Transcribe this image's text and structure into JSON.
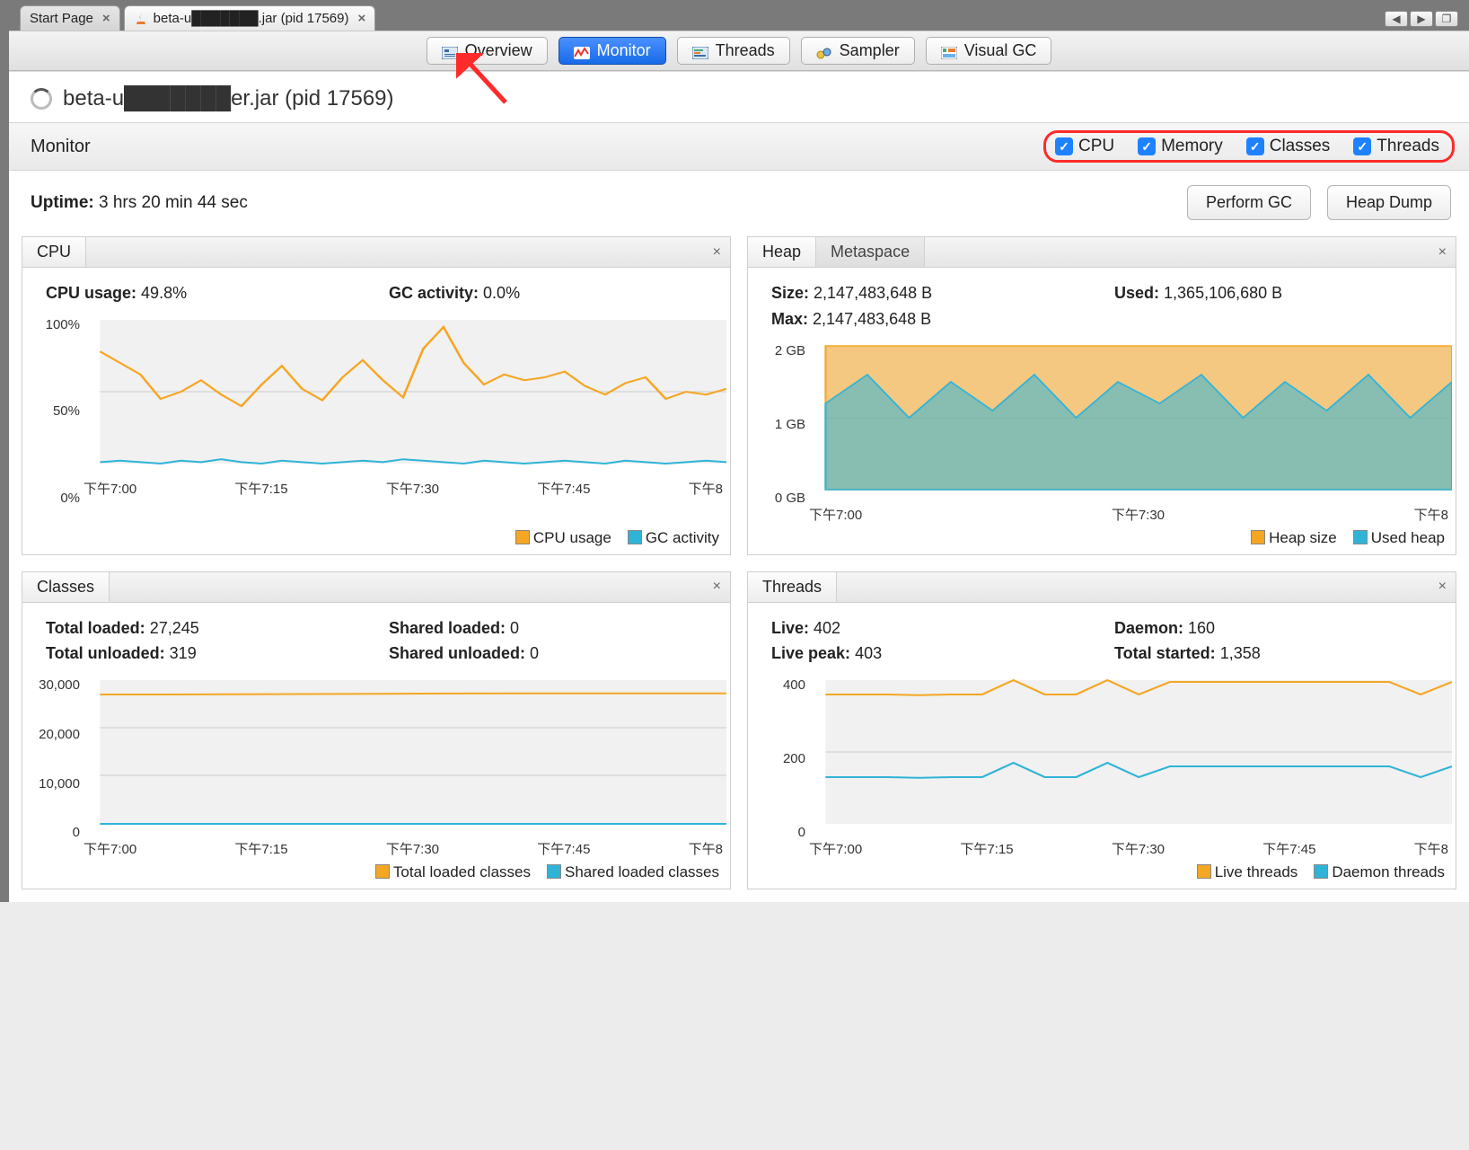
{
  "window": {
    "tabs": [
      {
        "label": "Start Page",
        "active": false
      },
      {
        "label": "beta-u███████.jar (pid 17569)",
        "active": true
      }
    ]
  },
  "nav_tabs": [
    {
      "label": "Overview",
      "selected": false,
      "icon": "overview-icon"
    },
    {
      "label": "Monitor",
      "selected": true,
      "icon": "monitor-icon"
    },
    {
      "label": "Threads",
      "selected": false,
      "icon": "threads-icon"
    },
    {
      "label": "Sampler",
      "selected": false,
      "icon": "sampler-icon"
    },
    {
      "label": "Visual GC",
      "selected": false,
      "icon": "visualgc-icon"
    }
  ],
  "page_title": "beta-u███████er.jar (pid 17569)",
  "section_label": "Monitor",
  "checks": [
    {
      "label": "CPU",
      "checked": true
    },
    {
      "label": "Memory",
      "checked": true
    },
    {
      "label": "Classes",
      "checked": true
    },
    {
      "label": "Threads",
      "checked": true
    }
  ],
  "uptime_label": "Uptime:",
  "uptime_value": "3 hrs 20 min 44 sec",
  "actions": {
    "perform_gc": "Perform GC",
    "heap_dump": "Heap Dump"
  },
  "cpu": {
    "title": "CPU",
    "usage_label": "CPU usage:",
    "usage_value": "49.8%",
    "gc_label": "GC activity:",
    "gc_value": "0.0%",
    "legend": [
      "CPU usage",
      "GC activity"
    ]
  },
  "heap": {
    "tabs": [
      "Heap",
      "Metaspace"
    ],
    "size_label": "Size:",
    "size_value": "2,147,483,648 B",
    "used_label": "Used:",
    "used_value": "1,365,106,680 B",
    "max_label": "Max:",
    "max_value": "2,147,483,648 B",
    "legend": [
      "Heap size",
      "Used heap"
    ]
  },
  "classes": {
    "title": "Classes",
    "total_loaded_label": "Total loaded:",
    "total_loaded_value": "27,245",
    "shared_loaded_label": "Shared loaded:",
    "shared_loaded_value": "0",
    "total_unloaded_label": "Total unloaded:",
    "total_unloaded_value": "319",
    "shared_unloaded_label": "Shared unloaded:",
    "shared_unloaded_value": "0",
    "legend": [
      "Total loaded classes",
      "Shared loaded classes"
    ]
  },
  "threads": {
    "title": "Threads",
    "live_label": "Live:",
    "live_value": "402",
    "daemon_label": "Daemon:",
    "daemon_value": "160",
    "peak_label": "Live peak:",
    "peak_value": "403",
    "started_label": "Total started:",
    "started_value": "1,358",
    "legend": [
      "Live threads",
      "Daemon threads"
    ]
  },
  "chart_data": [
    {
      "name": "CPU",
      "type": "line",
      "xlabel": "",
      "ylabel": "%",
      "ylim": [
        0,
        100
      ],
      "x_ticks": [
        "下午7:00",
        "下午7:15",
        "下午7:30",
        "下午7:45",
        "下午8"
      ],
      "y_ticks": [
        "100%",
        "50%",
        "0%"
      ],
      "series": [
        {
          "name": "CPU usage",
          "color": "#f5a623",
          "values": [
            78,
            70,
            62,
            45,
            50,
            58,
            48,
            40,
            55,
            68,
            52,
            44,
            60,
            72,
            58,
            46,
            80,
            95,
            70,
            55,
            62,
            58,
            60,
            64,
            54,
            48,
            56,
            60,
            45,
            50,
            48,
            52
          ]
        },
        {
          "name": "GC activity",
          "color": "#2fb4d8",
          "values": [
            1,
            2,
            1,
            0,
            2,
            1,
            3,
            1,
            0,
            2,
            1,
            0,
            1,
            2,
            1,
            3,
            2,
            1,
            0,
            2,
            1,
            0,
            1,
            2,
            1,
            0,
            2,
            1,
            0,
            1,
            2,
            1
          ]
        }
      ]
    },
    {
      "name": "Heap",
      "type": "area",
      "xlabel": "",
      "ylabel": "GB",
      "ylim": [
        0,
        2
      ],
      "x_ticks": [
        "下午7:00",
        "下午7:30",
        "下午8"
      ],
      "y_ticks": [
        "2 GB",
        "1 GB",
        "0 GB"
      ],
      "series": [
        {
          "name": "Heap size",
          "color": "#f5a623",
          "values": [
            2.0,
            2.0,
            2.0,
            2.0,
            2.0,
            2.0,
            2.0,
            2.0,
            2.0,
            2.0,
            2.0,
            2.0,
            2.0,
            2.0,
            2.0,
            2.0
          ]
        },
        {
          "name": "Used heap",
          "color": "#2fb4d8",
          "values": [
            1.2,
            1.6,
            1.0,
            1.5,
            1.1,
            1.6,
            1.0,
            1.5,
            1.2,
            1.6,
            1.0,
            1.5,
            1.1,
            1.6,
            1.0,
            1.5
          ]
        }
      ]
    },
    {
      "name": "Classes",
      "type": "line",
      "xlabel": "",
      "ylabel": "",
      "ylim": [
        0,
        30000
      ],
      "x_ticks": [
        "下午7:00",
        "下午7:15",
        "下午7:30",
        "下午7:45",
        "下午8"
      ],
      "y_ticks": [
        "30,000",
        "20,000",
        "10,000",
        "0"
      ],
      "series": [
        {
          "name": "Total loaded classes",
          "color": "#f5a623",
          "values": [
            27000,
            27000,
            27050,
            27100,
            27150,
            27200,
            27245,
            27245,
            27245,
            27245
          ]
        },
        {
          "name": "Shared loaded classes",
          "color": "#2fb4d8",
          "values": [
            0,
            0,
            0,
            0,
            0,
            0,
            0,
            0,
            0,
            0
          ]
        }
      ]
    },
    {
      "name": "Threads",
      "type": "line",
      "xlabel": "",
      "ylabel": "",
      "ylim": [
        0,
        400
      ],
      "x_ticks": [
        "下午7:00",
        "下午7:15",
        "下午7:30",
        "下午7:45",
        "下午8"
      ],
      "y_ticks": [
        "400",
        "200",
        "0"
      ],
      "series": [
        {
          "name": "Live threads",
          "color": "#f5a623",
          "values": [
            360,
            360,
            360,
            358,
            360,
            360,
            400,
            360,
            360,
            400,
            360,
            395,
            395,
            395,
            395,
            395,
            395,
            395,
            395,
            360,
            395
          ]
        },
        {
          "name": "Daemon threads",
          "color": "#2fb4d8",
          "values": [
            130,
            130,
            130,
            128,
            130,
            130,
            170,
            130,
            130,
            170,
            130,
            160,
            160,
            160,
            160,
            160,
            160,
            160,
            160,
            130,
            160
          ]
        }
      ]
    }
  ]
}
